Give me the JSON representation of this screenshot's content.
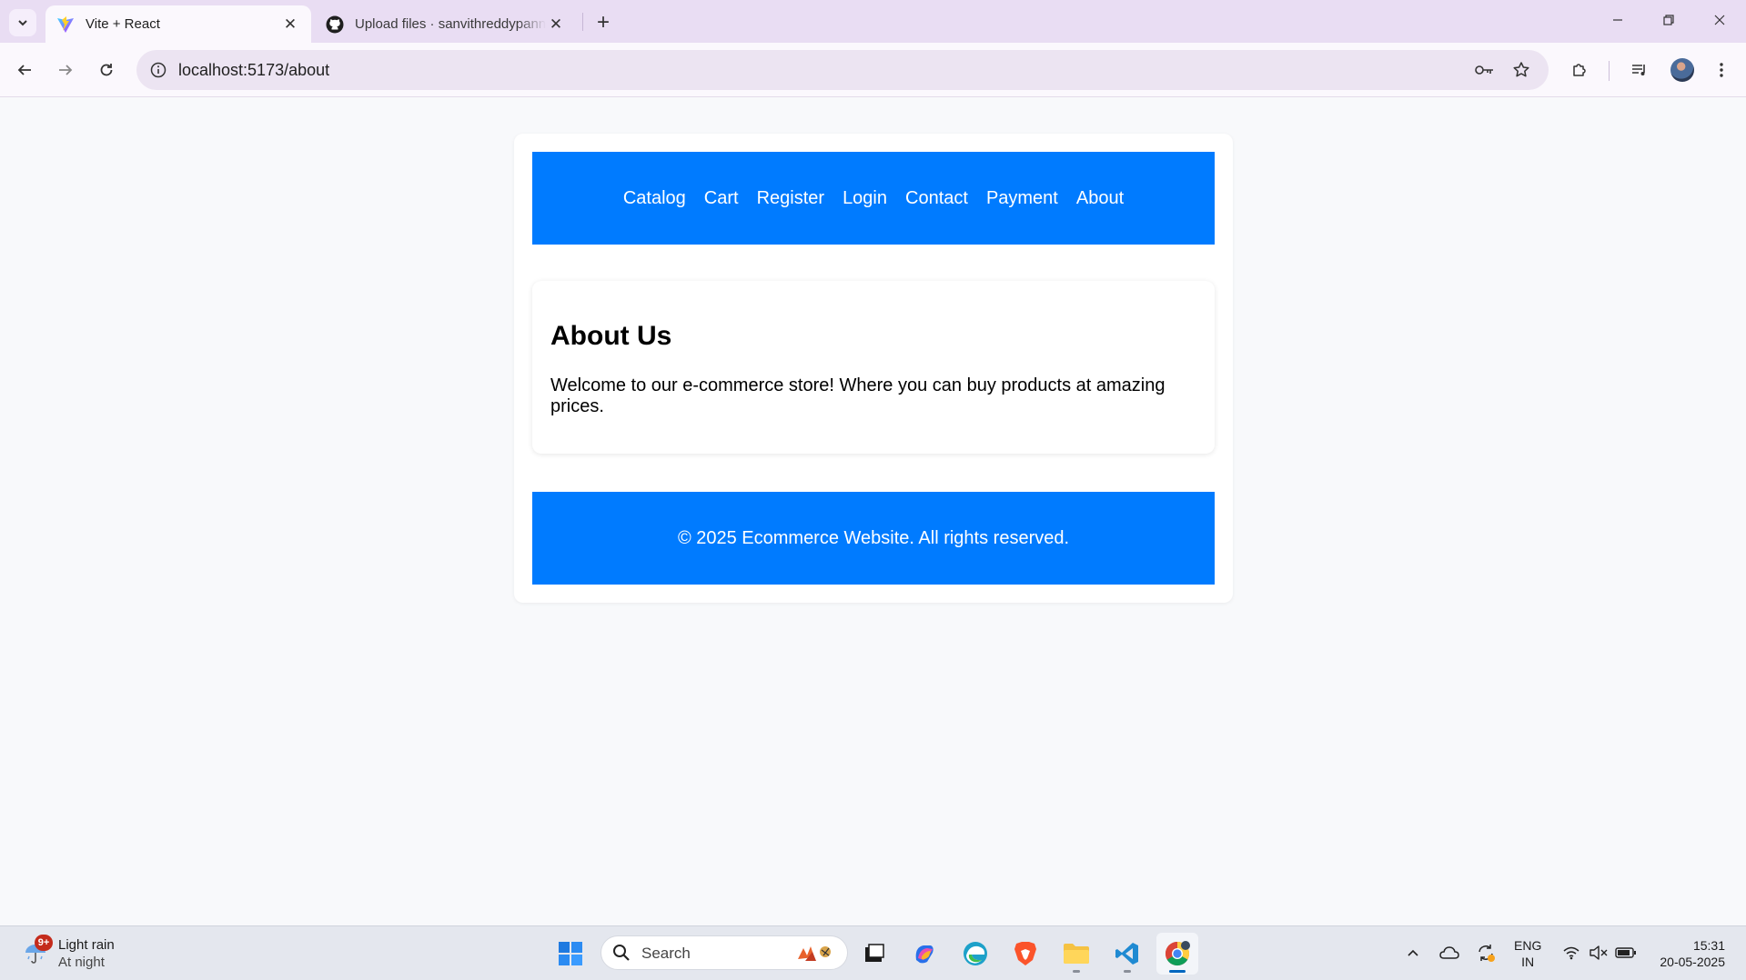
{
  "browser": {
    "tabs": [
      {
        "title": "Vite + React",
        "icon": "vite-icon",
        "active": true
      },
      {
        "title": "Upload files · sanvithreddypann",
        "icon": "github-icon",
        "active": false
      }
    ],
    "url": "localhost:5173/about"
  },
  "page": {
    "nav": [
      "Catalog",
      "Cart",
      "Register",
      "Login",
      "Contact",
      "Payment",
      "About"
    ],
    "about": {
      "heading": "About Us",
      "text": "Welcome to our e-commerce store! Where you can buy products at amazing prices."
    },
    "footer": "© 2025 Ecommerce Website. All rights reserved."
  },
  "taskbar": {
    "weather": {
      "badge": "9+",
      "line1": "Light rain",
      "line2": "At night"
    },
    "search_placeholder": "Search",
    "language": {
      "line1": "ENG",
      "line2": "IN"
    },
    "time": "15:31",
    "date": "20-05-2025"
  },
  "colors": {
    "accent": "#007bff",
    "tabstrip": "#e9ddf3"
  }
}
